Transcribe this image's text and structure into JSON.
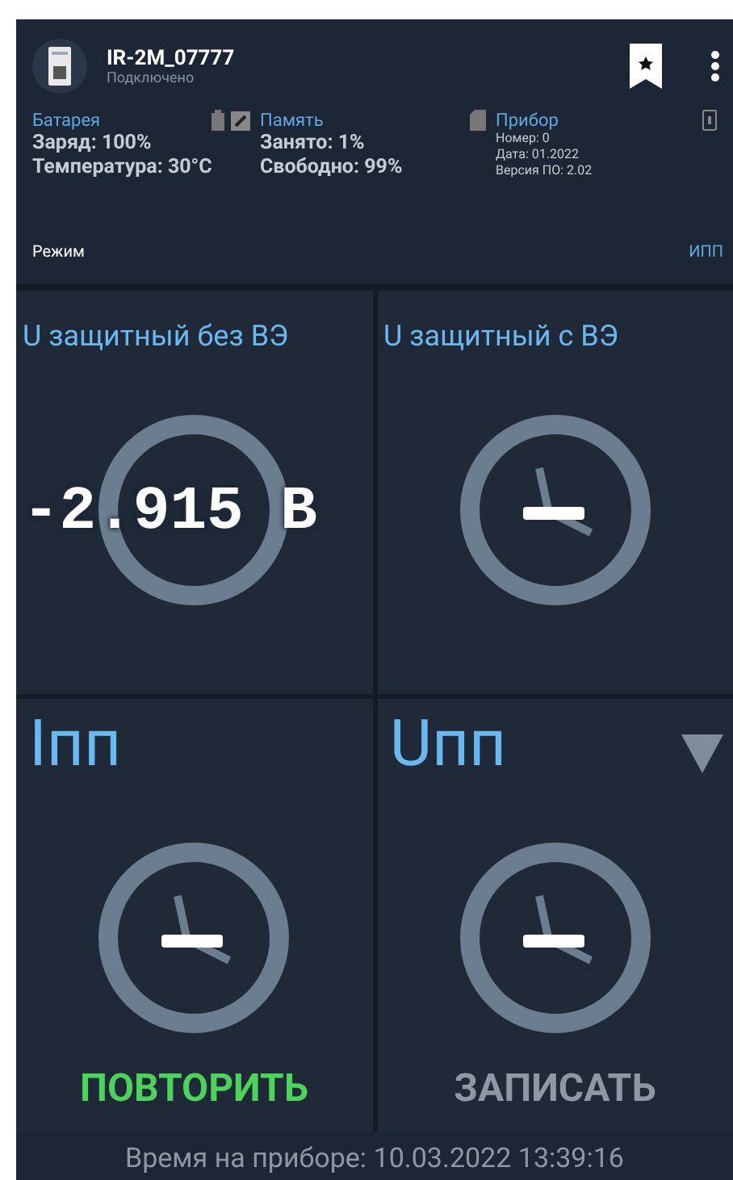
{
  "device": {
    "name": "IR-2M_07777",
    "status": "Подключено"
  },
  "info": [
    {
      "title": "Батарея",
      "lines": [
        "Заряд: 100%",
        "Температура: 30°C"
      ],
      "kind": "battery"
    },
    {
      "title": "Память",
      "lines": [
        "Занято: 1%",
        "Свободно: 99%"
      ],
      "kind": "memory"
    },
    {
      "title": "Прибор",
      "lines": [
        "Номер: 0",
        "Дата: 01.2022",
        "Версия ПО: 2.02"
      ],
      "kind": "device"
    }
  ],
  "mode": {
    "label": "Режим",
    "value": "ИПП"
  },
  "tiles": [
    {
      "title": "U защитный без ВЭ",
      "value": "-2.915 В",
      "kind": "small",
      "dropdown": false
    },
    {
      "title": "U защитный с ВЭ",
      "kind": "small",
      "dropdown": false
    },
    {
      "title": "Iпп",
      "kind": "large",
      "dropdown": false
    },
    {
      "title": "Uпп",
      "kind": "large",
      "dropdown": true
    }
  ],
  "buttons": [
    {
      "label": "ПОВТОРИТЬ",
      "disabled": false
    },
    {
      "label": "ЗАПИСАТЬ",
      "disabled": true
    }
  ],
  "footer": "Время на приборе: 10.03.2022 13:39:16"
}
